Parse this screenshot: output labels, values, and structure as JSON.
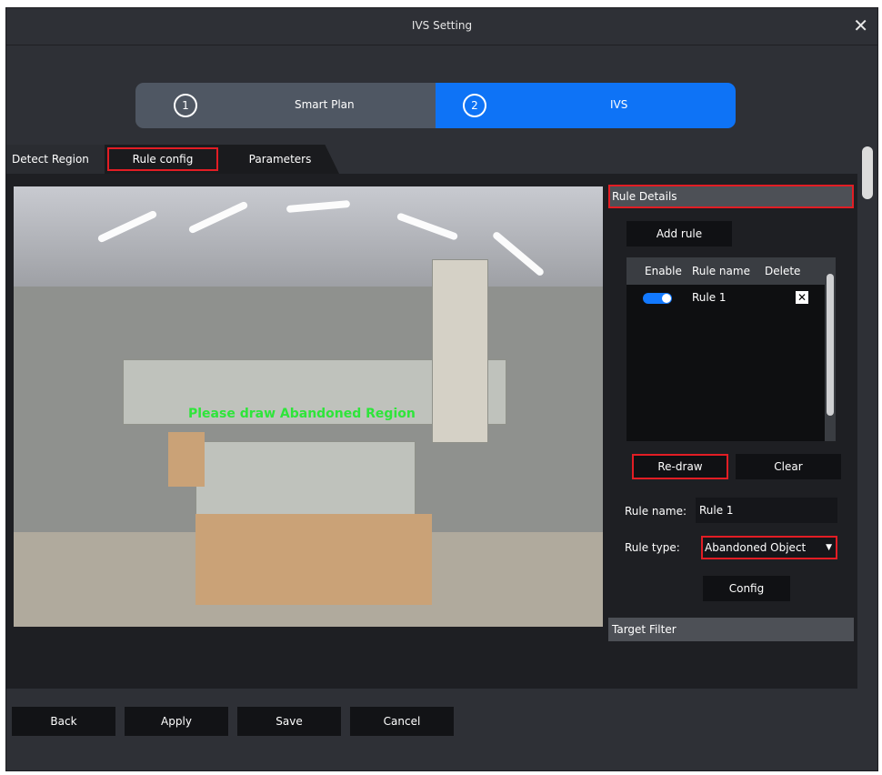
{
  "window": {
    "title": "IVS Setting",
    "close_glyph": "✕"
  },
  "stepper": {
    "steps": [
      {
        "num": "1",
        "label": "Smart Plan"
      },
      {
        "num": "2",
        "label": "IVS"
      }
    ],
    "active_step": 2,
    "active_color": "#0e73f6"
  },
  "tabs": [
    "Detect Region",
    "Rule config",
    "Parameters"
  ],
  "video": {
    "overlay_text": "Please draw Abandoned Region"
  },
  "rule_details": {
    "header": "Rule Details",
    "add_rule_label": "Add rule",
    "columns": [
      "Enable",
      "Rule name",
      "Delete"
    ],
    "rows": [
      {
        "enabled": true,
        "name": "Rule 1",
        "delete_glyph": "✕"
      }
    ],
    "redraw_label": "Re-draw",
    "clear_label": "Clear",
    "rule_name_label": "Rule name:",
    "rule_name_value": "Rule 1",
    "rule_type_label": "Rule type:",
    "rule_type_value": "Abandoned Object",
    "config_label": "Config"
  },
  "target_filter": {
    "header": "Target Filter"
  },
  "footer": {
    "back": "Back",
    "apply": "Apply",
    "save": "Save",
    "cancel": "Cancel"
  },
  "icons": {
    "close": "close-icon",
    "dropdown": "chevron-down-icon",
    "scroll_up": "arrow-up-icon",
    "scroll_down": "arrow-down-icon"
  }
}
